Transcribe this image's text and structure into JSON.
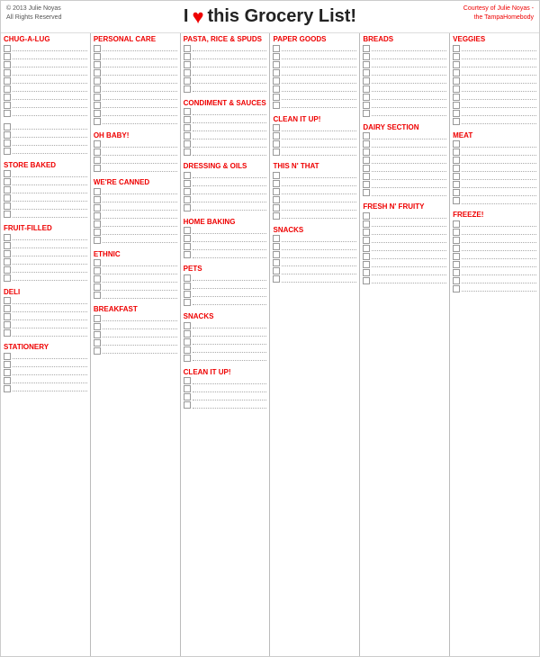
{
  "header": {
    "title": "I ",
    "heart": "♥",
    "title2": " this Grocery List!",
    "left_line1": "© 2013 Julie Noyas",
    "left_line2": "All Rights Reserved",
    "right_line1": "Courtesy of Julie Noyas -",
    "right_line2": "the TampaHomebody"
  },
  "columns": [
    {
      "id": "col1",
      "sections": [
        {
          "label": "CHUG-A-LUG",
          "icon": "🥤",
          "rows": 9
        },
        {
          "label": "",
          "icon": "",
          "rows": 4
        },
        {
          "label": "STORE BAKED",
          "icon": "🎂",
          "rows": 6
        },
        {
          "label": "FRUIT-FILLED",
          "icon": "📗",
          "rows": 6
        },
        {
          "label": "DELI",
          "icon": "🥩",
          "rows": 5
        },
        {
          "label": "STATIONERY",
          "icon": "📦",
          "rows": 5
        }
      ]
    },
    {
      "id": "col2",
      "sections": [
        {
          "label": "PERSONAL CARE",
          "icon": "💄",
          "rows": 10
        },
        {
          "label": "OH BABY!",
          "icon": "🍼",
          "rows": 4
        },
        {
          "label": "WE'RE CANNED",
          "icon": "🥫",
          "rows": 7
        },
        {
          "label": "ETHNIC",
          "icon": "🌮",
          "rows": 5
        },
        {
          "label": "BREAKFAST",
          "icon": "☕",
          "rows": 5
        }
      ]
    },
    {
      "id": "col3",
      "sections": [
        {
          "label": "PASTA, RICE & SPUDS",
          "icon": "🥕",
          "rows": 6
        },
        {
          "label": "CONDIMENT & SAUCES",
          "icon": "🧴",
          "rows": 6
        },
        {
          "label": "DRESSING & OILS",
          "icon": "🫙",
          "rows": 5
        },
        {
          "label": "HOME BAKING",
          "icon": "🧁",
          "rows": 4
        },
        {
          "label": "PETS",
          "icon": "🐶🐱",
          "rows": 4
        },
        {
          "label": "SNACKS",
          "icon": "🧁",
          "rows": 5
        },
        {
          "label": "CLEAN IT UP!",
          "icon": "🧹",
          "rows": 4
        }
      ]
    },
    {
      "id": "col4",
      "sections": [
        {
          "label": "PAPER GOODS",
          "icon": "🧻",
          "rows": 8
        },
        {
          "label": "CLEAN IT UP!",
          "icon": "🧴",
          "rows": 4
        },
        {
          "label": "THIS N' THAT",
          "icon": "💡",
          "rows": 6
        },
        {
          "label": "SNACKS",
          "icon": "🍭",
          "rows": 6
        }
      ]
    },
    {
      "id": "col5",
      "sections": [
        {
          "label": "BREADS",
          "icon": "🍞",
          "rows": 9
        },
        {
          "label": "DAIRY SECTION",
          "icon": "🥛",
          "rows": 8
        },
        {
          "label": "FRESH N' FRUITY",
          "icon": "🍎",
          "rows": 9
        }
      ]
    },
    {
      "id": "col6",
      "sections": [
        {
          "label": "VEGGIES",
          "icon": "🥦",
          "rows": 10
        },
        {
          "label": "MEAT",
          "icon": "🥩",
          "rows": 8
        },
        {
          "label": "FREEZE!",
          "icon": "🍦",
          "rows": 9
        }
      ]
    }
  ]
}
